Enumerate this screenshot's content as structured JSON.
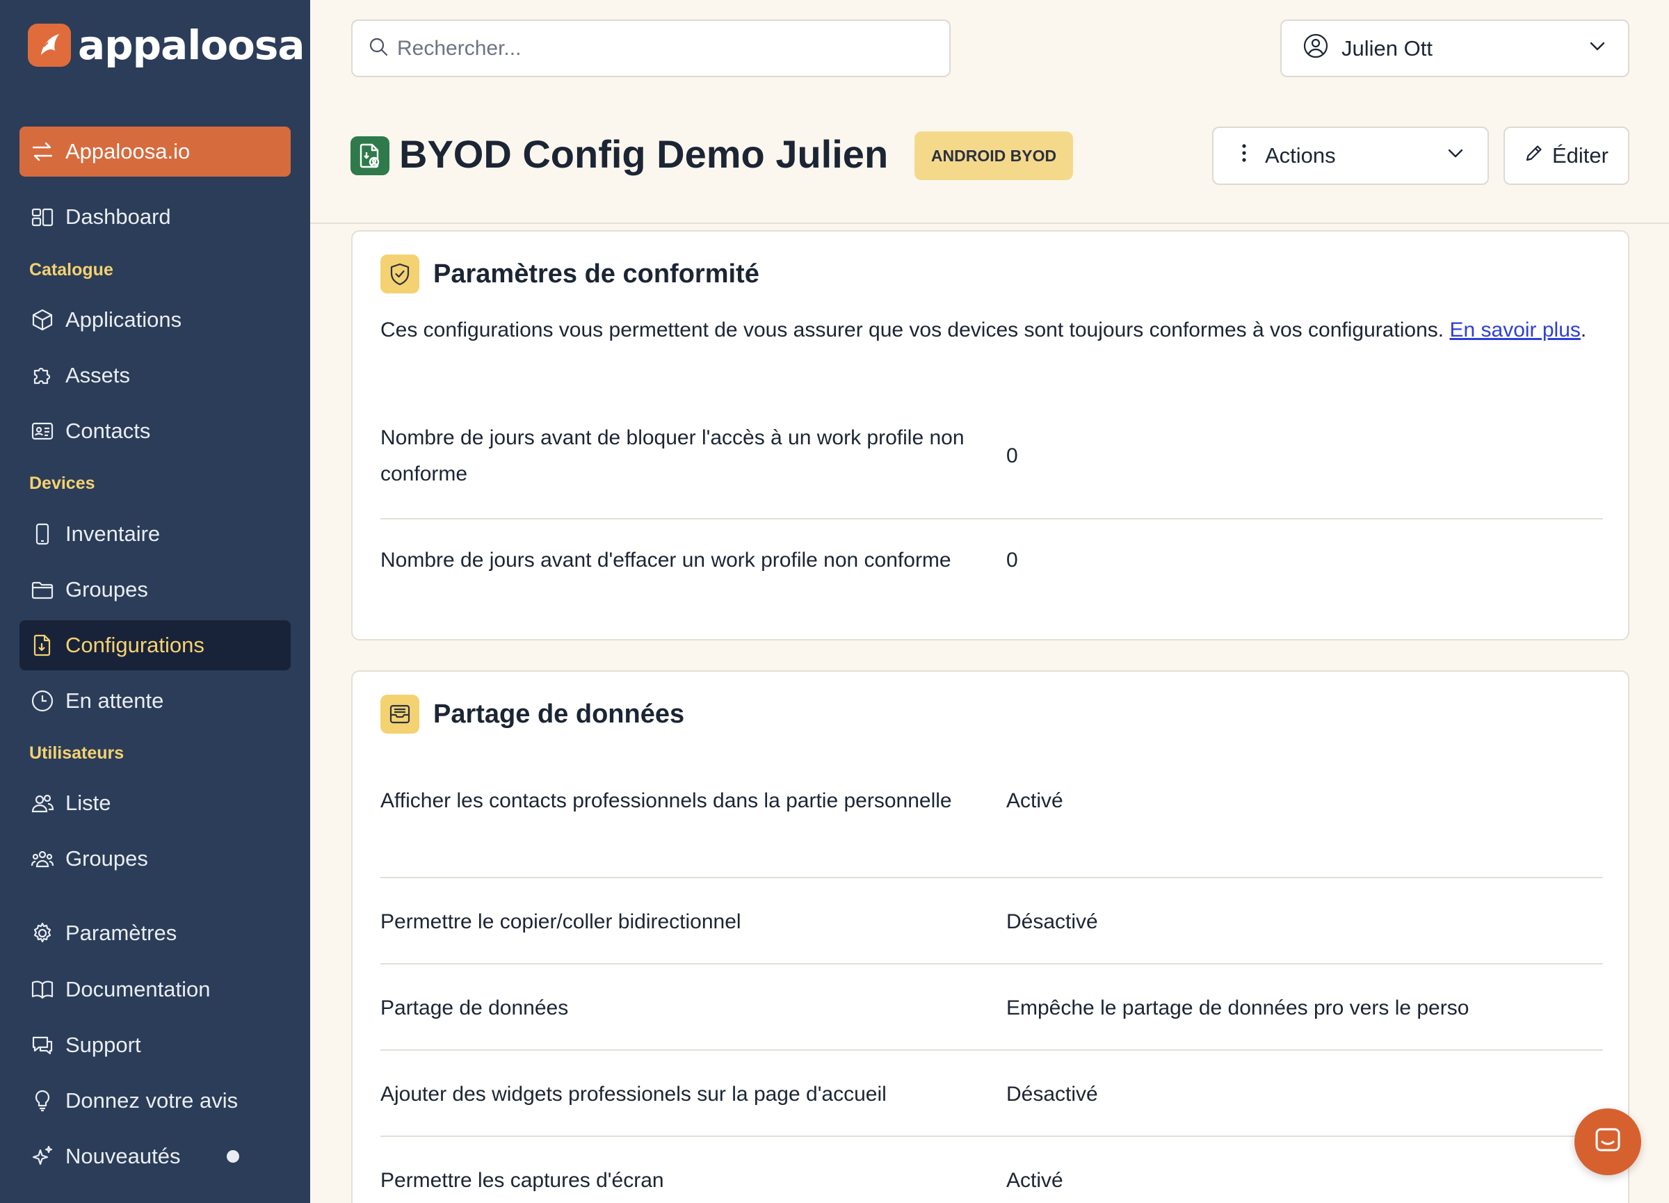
{
  "brand": {
    "name": "appaloosa",
    "accent": "#d66b3e",
    "sidebar_bg": "#2b3d58",
    "highlight": "#f5d271"
  },
  "sidebar": {
    "org_switch": "Appaloosa.io",
    "dashboard": "Dashboard",
    "sections": {
      "catalogue": "Catalogue",
      "devices": "Devices",
      "users": "Utilisateurs"
    },
    "items": {
      "applications": "Applications",
      "assets": "Assets",
      "contacts": "Contacts",
      "inventaire": "Inventaire",
      "groupes_devices": "Groupes",
      "configurations": "Configurations",
      "en_attente": "En attente",
      "liste": "Liste",
      "groupes_users": "Groupes",
      "parametres": "Paramètres",
      "documentation": "Documentation",
      "support": "Support",
      "avis": "Donnez votre avis",
      "nouveautes": "Nouveautés"
    }
  },
  "topbar": {
    "search_placeholder": "Rechercher...",
    "user_name": "Julien Ott"
  },
  "header": {
    "title": "BYOD Config Demo Julien",
    "badge": "ANDROID BYOD",
    "actions_label": "Actions",
    "edit_label": "Éditer"
  },
  "compliance": {
    "title": "Paramètres de conformité",
    "description": "Ces configurations vous permettent de vous assurer que vos devices sont toujours conformes à vos configurations.",
    "link_text": "En savoir plus",
    "rows": [
      {
        "label": "Nombre de jours avant de bloquer l'accès à un work profile non conforme",
        "value": "0"
      },
      {
        "label": "Nombre de jours avant d'effacer un work profile non conforme",
        "value": "0"
      }
    ]
  },
  "sharing": {
    "title": "Partage de données",
    "rows": [
      {
        "label": "Afficher les contacts professionnels dans la partie personnelle",
        "value": "Activé"
      },
      {
        "label": "Permettre le copier/coller bidirectionnel",
        "value": "Désactivé"
      },
      {
        "label": "Partage de données",
        "value": "Empêche le partage de données pro vers le perso"
      },
      {
        "label": "Ajouter des widgets professionels sur la page d'accueil",
        "value": "Désactivé"
      },
      {
        "label": "Permettre les captures d'écran",
        "value": "Activé"
      }
    ]
  }
}
